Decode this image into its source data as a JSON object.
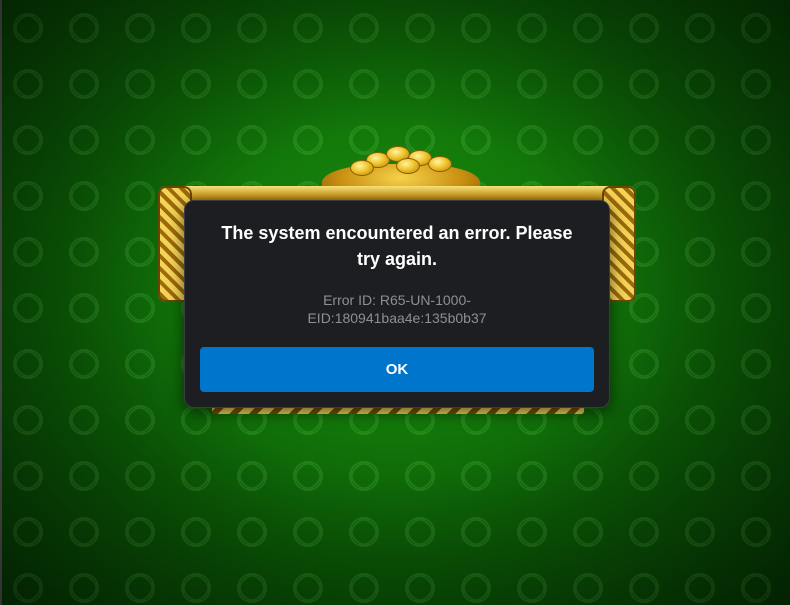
{
  "dialog": {
    "title": "The system encountered an error. Please try again.",
    "error_id_line1": "Error ID: R65-UN-1000-",
    "error_id_line2": "EID:180941baa4e:135b0b37",
    "ok_label": "OK"
  },
  "colors": {
    "background": "#137a0a",
    "dialog_bg": "#1d1e22",
    "ok_button": "#0075cc",
    "error_text": "#8d8f96",
    "gold": "#c8961c"
  }
}
